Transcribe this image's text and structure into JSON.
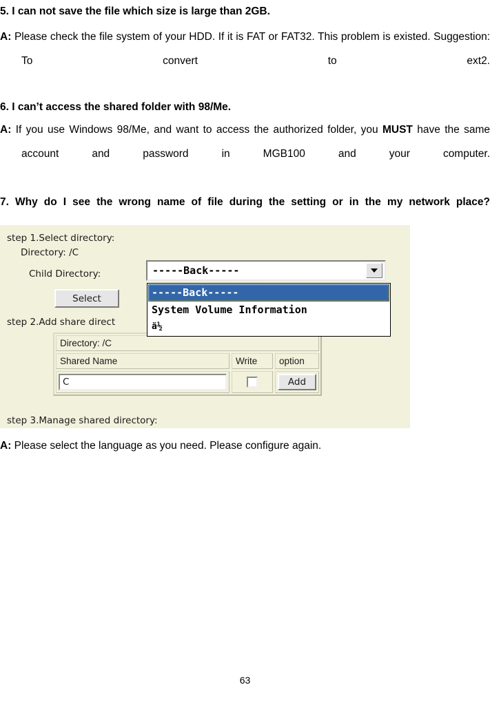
{
  "document": {
    "faq": [
      {
        "question": "5. I can not save the file which size is large than 2GB.",
        "answer_lead": "A:",
        "answer": "Please check the file system of your HDD. If it is FAT or FAT32. This problem is existed. Suggestion: To convert to ext2."
      },
      {
        "question": "6. I can’t access the shared folder with 98/Me.",
        "answer_lead": "A:",
        "answer_part1": "If you use Windows 98/Me, and want to access the authorized folder, you ",
        "answer_emphasis": "MUST",
        "answer_part2": " have the same account and password in MGB100 and your computer."
      },
      {
        "question": "7. Why do I see the wrong name of file during the setting or in the my network place?",
        "answer_lead": "A:",
        "answer": "Please select the language as you need. Please configure again."
      }
    ],
    "page_number": "63"
  },
  "screenshot": {
    "step1": {
      "label": "step 1.Select directory:",
      "directory_label": "Directory: /C",
      "child_directory_label": "Child Directory:",
      "combo_value": "-----Back-----",
      "dropdown_options": [
        "-----Back-----",
        "System Volume Information",
        "ä½"
      ],
      "selected_option": "-----Back-----",
      "select_button": "Select"
    },
    "step2": {
      "label": "step 2.Add share direct",
      "directory_row": "Directory: /C",
      "headers": [
        "Shared Name",
        "Write",
        "option"
      ],
      "shared_name_value": "C",
      "write_checked": false,
      "add_button": "Add"
    },
    "step3": {
      "label": "step 3.Manage shared directory:"
    },
    "colors": {
      "panel_background": "#f1f1dc",
      "selection_blue": "#3266a8",
      "button_face": "#e6e6e6"
    }
  }
}
